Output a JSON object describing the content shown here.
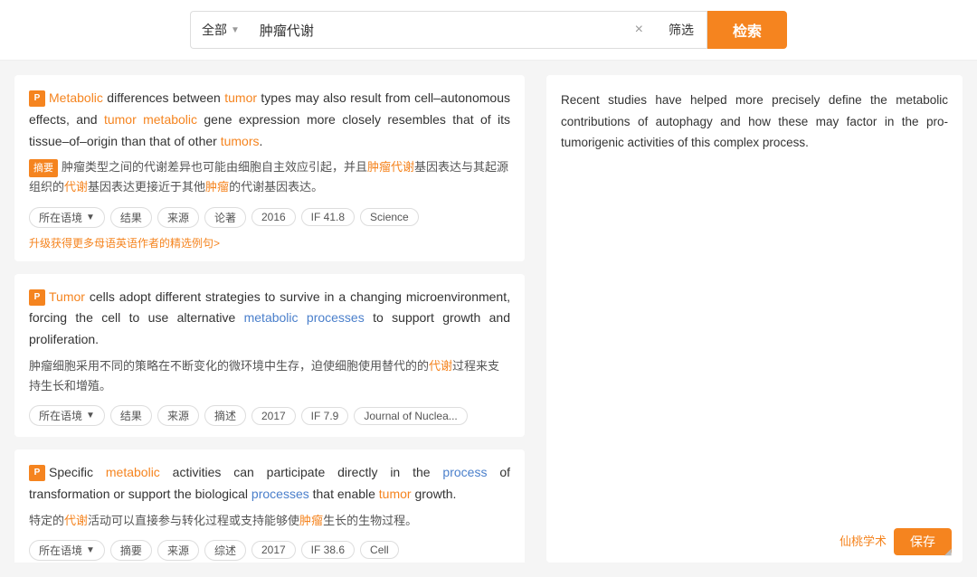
{
  "search": {
    "category": "全部",
    "category_chevron": "▼",
    "query": "肿瘤代谢",
    "clear_label": "×",
    "filter_label": "筛选",
    "search_label": "检索"
  },
  "results": [
    {
      "icon": "P",
      "en_parts": [
        {
          "text": "Metabolic",
          "style": "orange"
        },
        {
          "text": " differences between ",
          "style": "normal"
        },
        {
          "text": "tumor",
          "style": "orange"
        },
        {
          "text": " types may also result from cell–autonomous effects, and ",
          "style": "normal"
        },
        {
          "text": "tumor",
          "style": "orange"
        },
        {
          "text": " ",
          "style": "normal"
        },
        {
          "text": "metabolic",
          "style": "orange"
        },
        {
          "text": " gene expression more closely resembles that of its tissue–of–origin than that of other ",
          "style": "normal"
        },
        {
          "text": "tumors",
          "style": "orange"
        },
        {
          "text": ".",
          "style": "normal"
        }
      ],
      "zh_tag": "摘要",
      "zh_text": "肿瘤类型之间的代谢差异也可能由细胞自主效应引起，并且",
      "zh_highlight1": "肿瘤代谢",
      "zh_text2": "基因表达与其起源组织的",
      "zh_highlight2": "代谢",
      "zh_text3": "基因表达更接近于其他",
      "zh_highlight3": "肿瘤",
      "zh_text4": "的代谢基因表达。",
      "tags": [
        "所在语境",
        "结果",
        "来源",
        "论著",
        "2016",
        "IF 41.8",
        "Science"
      ],
      "upgrade_link": "升级获得更多母语英语作者的精选例句>"
    },
    {
      "icon": "P",
      "en_parts": [
        {
          "text": "Tumor",
          "style": "orange"
        },
        {
          "text": " cells adopt different strategies to survive in a changing microenvironment, forcing the cell to use alternative ",
          "style": "normal"
        },
        {
          "text": "metabolic processes",
          "style": "blue"
        },
        {
          "text": " to support growth and proliferation.",
          "style": "normal"
        }
      ],
      "zh_tag": null,
      "zh_text": "肿瘤细胞采用不同的策略在不断变化的微环境中生存，迫使细胞使用替代的的",
      "zh_highlight1": "代谢",
      "zh_text2": "过程来支持生长和增殖。",
      "zh_highlight2": null,
      "zh_text3": null,
      "zh_highlight3": null,
      "zh_text4": null,
      "tags": [
        "所在语境",
        "结果",
        "来源",
        "摘述",
        "2017",
        "IF 7.9",
        "Journal of Nuclea..."
      ],
      "upgrade_link": null
    },
    {
      "icon": "P",
      "en_parts": [
        {
          "text": "Specific ",
          "style": "normal"
        },
        {
          "text": "metabolic",
          "style": "orange"
        },
        {
          "text": " activities can participate directly in the ",
          "style": "normal"
        },
        {
          "text": "process",
          "style": "blue"
        },
        {
          "text": " of transformation or support the biological ",
          "style": "normal"
        },
        {
          "text": "processes",
          "style": "blue"
        },
        {
          "text": " that enable ",
          "style": "normal"
        },
        {
          "text": "tumor",
          "style": "orange"
        },
        {
          "text": " growth.",
          "style": "normal"
        }
      ],
      "zh_tag": null,
      "zh_text": "特定的",
      "zh_highlight1": "代谢",
      "zh_text2": "活动可以直接参与转化过程或支持能够使",
      "zh_highlight2": "肿瘤",
      "zh_text3": "生长的生物过程。",
      "zh_highlight3": null,
      "zh_text4": null,
      "zh_text5": null,
      "tags": [
        "所在语境",
        "摘要",
        "来源",
        "综述",
        "2017",
        "IF 38.6",
        "Cell"
      ],
      "upgrade_link": null
    }
  ],
  "right_panel": {
    "text": "Recent studies have helped more precisely define the metabolic contributions of autophagy and how these may factor in the pro-tumorigenic activities of this complex process."
  },
  "logo": "仙桃学术",
  "save_label": "保存"
}
